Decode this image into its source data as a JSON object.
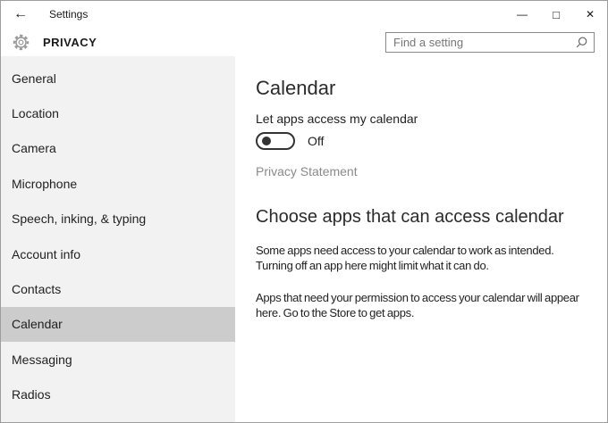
{
  "window": {
    "title": "Settings",
    "icons": {
      "back": "←",
      "minimize": "—",
      "maximize": "□",
      "close": "✕"
    }
  },
  "header": {
    "page_title": "PRIVACY",
    "search": {
      "placeholder": "Find a setting"
    }
  },
  "sidebar": {
    "items": [
      {
        "label": "General",
        "selected": false
      },
      {
        "label": "Location",
        "selected": false
      },
      {
        "label": "Camera",
        "selected": false
      },
      {
        "label": "Microphone",
        "selected": false
      },
      {
        "label": "Speech, inking, & typing",
        "selected": false
      },
      {
        "label": "Account info",
        "selected": false
      },
      {
        "label": "Contacts",
        "selected": false
      },
      {
        "label": "Calendar",
        "selected": true
      },
      {
        "label": "Messaging",
        "selected": false
      },
      {
        "label": "Radios",
        "selected": false
      }
    ]
  },
  "main": {
    "section_title": "Calendar",
    "toggle": {
      "label": "Let apps access my calendar",
      "state": "Off"
    },
    "privacy_link": "Privacy Statement",
    "choose_heading": "Choose apps that can access calendar",
    "paragraphs": [
      "Some apps need access to your calendar to work as intended.\nTurning off an app here might limit what it can do.",
      "Apps that need your permission to access your calendar will appear\nhere. Go to the Store to get apps."
    ]
  },
  "colors": {
    "sidebar_bg": "#f2f2f2",
    "selected_item_bg": "#cccccc",
    "window_border": "#9d9d9d",
    "link_gray": "#8a8a8a",
    "text": "#1f1f1f"
  }
}
